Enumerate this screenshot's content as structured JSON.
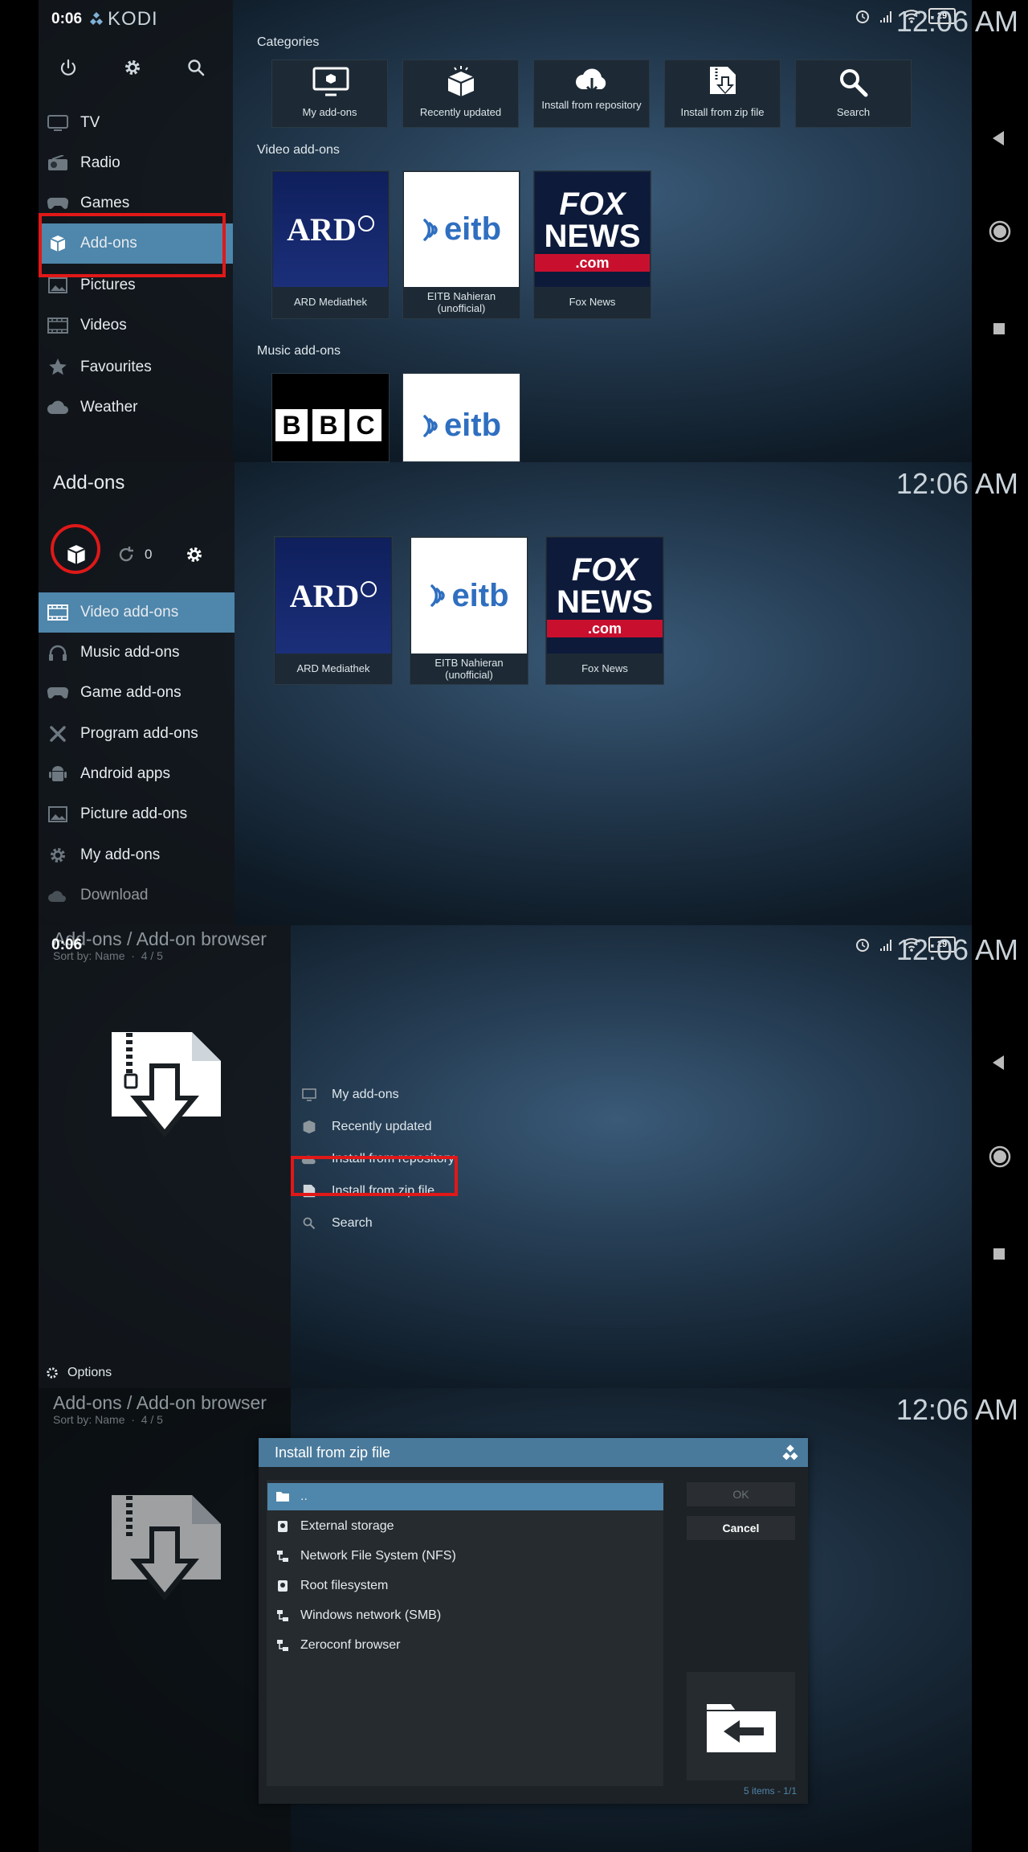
{
  "status": {
    "time": "0:06",
    "battery": "29"
  },
  "clock": "12:06 AM",
  "panel1": {
    "logo": "KODI",
    "sidebar": [
      {
        "label": "TV",
        "icon": "tv-icon"
      },
      {
        "label": "Radio",
        "icon": "radio-icon"
      },
      {
        "label": "Games",
        "icon": "gamepad-icon"
      },
      {
        "label": "Add-ons",
        "icon": "box-icon",
        "selected": true
      },
      {
        "label": "Pictures",
        "icon": "picture-icon"
      },
      {
        "label": "Videos",
        "icon": "film-icon"
      },
      {
        "label": "Favourites",
        "icon": "star-icon"
      },
      {
        "label": "Weather",
        "icon": "cloud-icon"
      }
    ],
    "categories_title": "Categories",
    "categories": [
      "My add-ons",
      "Recently updated",
      "Install from repository",
      "Install from zip file",
      "Search"
    ],
    "video_title": "Video add-ons",
    "video_addons": [
      "ARD Mediathek",
      "EITB Nahieran (unofficial)",
      "Fox News"
    ],
    "music_title": "Music add-ons",
    "logos": {
      "ard": "ARD",
      "eitb": "eitb",
      "fox1": "FOX",
      "fox2": "NEWS",
      "fox3": ".com",
      "bbc": [
        "B",
        "B",
        "C"
      ]
    }
  },
  "panel2": {
    "title": "Add-ons",
    "count": "0",
    "sidebar": [
      {
        "label": "Video add-ons",
        "icon": "film-icon",
        "selected": true
      },
      {
        "label": "Music add-ons",
        "icon": "headphones-icon"
      },
      {
        "label": "Game add-ons",
        "icon": "gamepad-icon"
      },
      {
        "label": "Program add-ons",
        "icon": "tools-icon"
      },
      {
        "label": "Android apps",
        "icon": "android-icon"
      },
      {
        "label": "Picture add-ons",
        "icon": "picture-icon"
      },
      {
        "label": "My add-ons",
        "icon": "gear-icon"
      },
      {
        "label": "Download",
        "icon": "cloud-download-icon"
      }
    ],
    "addons": [
      "ARD Mediathek",
      "EITB Nahieran (unofficial)",
      "Fox News"
    ]
  },
  "panel3": {
    "title": "Add-ons / Add-on browser",
    "subtitle": "Sort by: Name  ·  4 / 5",
    "list": [
      "My add-ons",
      "Recently updated",
      "Install from repository",
      "Install from zip file",
      "Search"
    ],
    "options": "Options"
  },
  "panel4": {
    "title": "Add-ons / Add-on browser",
    "subtitle": "Sort by: Name  ·  4 / 5",
    "dialog_title": "Install from zip file",
    "items": [
      "..",
      "External storage",
      "Network File System (NFS)",
      "Root filesystem",
      "Windows network (SMB)",
      "Zeroconf browser"
    ],
    "ok": "OK",
    "cancel": "Cancel",
    "footer": "5 items - 1/1"
  }
}
